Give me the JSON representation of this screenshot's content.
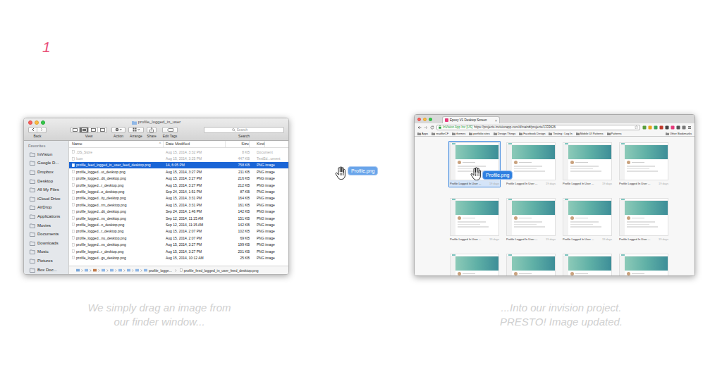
{
  "step": "1",
  "finder": {
    "title": "profile_logged_in_user",
    "toolbar": [
      {
        "label": "Back",
        "kind": "nav"
      },
      {
        "label": "View",
        "kind": "view"
      },
      {
        "label": "Action",
        "kind": "action"
      },
      {
        "label": "Arrange",
        "kind": "arrange"
      },
      {
        "label": "Share",
        "kind": "share"
      },
      {
        "label": "Edit Tags",
        "kind": "tags"
      }
    ],
    "search": {
      "placeholder": "Search",
      "label": "Search"
    },
    "sidebar": {
      "header": "Favorites",
      "items": [
        "InVision",
        "Google D...",
        "Dropbox",
        "Desktop",
        "All My Files",
        "iCloud Drive",
        "AirDrop",
        "Applications",
        "Movies",
        "Documents",
        "Downloads",
        "Music",
        "Pictures",
        "Box Doc..."
      ]
    },
    "columns": [
      {
        "label": "Name",
        "sort": "^"
      },
      {
        "label": "Date Modified"
      },
      {
        "label": "Size"
      },
      {
        "label": "Kind"
      }
    ],
    "rows": [
      {
        "name": ".DS_Store",
        "date": "Aug 15, 2014, 3:32 PM",
        "size": "8 KB",
        "kind": "Document",
        "selected": false,
        "disabled": true
      },
      {
        "name": "Icon",
        "date": "Aug 15, 2014, 3:25 PM",
        "size": "447 KB",
        "kind": "TextEd...ument",
        "selected": false,
        "disabled": true
      },
      {
        "name": "profile_feed_logged_in_user_feed_desktop.png",
        "date": "14, 6:05 PM",
        "size": "758 KB",
        "kind": "PNG image",
        "selected": true,
        "disabled": false
      },
      {
        "name": "profile_logged...ut_desktop.png",
        "date": "Aug 15, 2014, 3:27 PM",
        "size": "211 KB",
        "kind": "PNG image",
        "selected": false,
        "disabled": false
      },
      {
        "name": "profile_logged...dit_desktop.png",
        "date": "Aug 15, 2014, 3:27 PM",
        "size": "216 KB",
        "kind": "PNG image",
        "selected": false,
        "disabled": false
      },
      {
        "name": "profile_logged...r_desktop.png",
        "date": "Aug 15, 2014, 3:27 PM",
        "size": "212 KB",
        "kind": "PNG image",
        "selected": false,
        "disabled": false
      },
      {
        "name": "profile_logged...o_desktop.png",
        "date": "Sep 24, 2014, 1:51 PM",
        "size": "87 KB",
        "kind": "PNG image",
        "selected": false,
        "disabled": false
      },
      {
        "name": "profile_logged...ity_desktop.png",
        "date": "Aug 15, 2014, 3:31 PM",
        "size": "164 KB",
        "kind": "PNG image",
        "selected": false,
        "disabled": false
      },
      {
        "name": "profile_logged...rm_desktop.png",
        "date": "Aug 15, 2014, 3:31 PM",
        "size": "161 KB",
        "kind": "PNG image",
        "selected": false,
        "disabled": false
      },
      {
        "name": "profile_logged...dit_desktop.png",
        "date": "Sep 24, 2014, 1:46 PM",
        "size": "142 KB",
        "kind": "PNG image",
        "selected": false,
        "disabled": false
      },
      {
        "name": "profile_logged...ns_desktop.png",
        "date": "Sep 12, 2014, 11:15 AM",
        "size": "151 KB",
        "kind": "PNG image",
        "selected": false,
        "disabled": false
      },
      {
        "name": "profile_logged...n_desktop.png",
        "date": "Sep 12, 2014, 11:15 AM",
        "size": "142 KB",
        "kind": "PNG image",
        "selected": false,
        "disabled": false
      },
      {
        "name": "profile_logged...r_desktop.png",
        "date": "Aug 15, 2014, 2:07 PM",
        "size": "102 KB",
        "kind": "PNG image",
        "selected": false,
        "disabled": false
      },
      {
        "name": "profile_logged...nu_desktop.png",
        "date": "Aug 15, 2014, 2:07 PM",
        "size": "69 KB",
        "kind": "PNG image",
        "selected": false,
        "disabled": false
      },
      {
        "name": "profile_logged...ns_desktop.png",
        "date": "Aug 15, 2014, 3:27 PM",
        "size": "199 KB",
        "kind": "PNG image",
        "selected": false,
        "disabled": false
      },
      {
        "name": "profile_logged...r_desktop.png",
        "date": "Aug 15, 2014, 3:27 PM",
        "size": "201 KB",
        "kind": "PNG image",
        "selected": false,
        "disabled": false
      },
      {
        "name": "profile_logged...gs_desktop.png",
        "date": "Aug 15, 2014, 10:12 AM",
        "size": "25 KB",
        "kind": "PNG image",
        "selected": false,
        "disabled": false
      }
    ],
    "path": [
      "profile_logge...",
      "profile_feed_logged_in_user_feed_desktop.png"
    ]
  },
  "drag": {
    "label": "Profile.png"
  },
  "drop": {
    "label": "Profile.png"
  },
  "browser": {
    "tab": {
      "title": "Epoxy V1 Desktop Screen",
      "close": "×"
    },
    "site": "InVision App Inc [US]",
    "url": "https://projects.invisionapp.com/d/main#/projects/1333626",
    "bookmarks": [
      "Apps",
      "readforCF",
      "themes",
      "portfolio sites",
      "Design Things",
      "Facebook Design",
      "Testing : Log In",
      "Mobile UI Patterns",
      "Patterns"
    ],
    "other_bookmarks": "Other Bookmarks",
    "screens": [
      {
        "title": "Profile Logged In User ...",
        "age": "19 days",
        "selected": true
      },
      {
        "title": "Profile Logged In User ...",
        "age": "19 days",
        "selected": false
      },
      {
        "title": "Profile Logged In User ...",
        "age": "19 days",
        "selected": false
      },
      {
        "title": "Profile Logged In User ...",
        "age": "19 days",
        "selected": false
      },
      {
        "title": "Profile Logged In User ...",
        "age": "19 days",
        "selected": false
      },
      {
        "title": "Profile Logged In User ...",
        "age": "19 days",
        "selected": false
      },
      {
        "title": "Profile Logged In User ...",
        "age": "19 days",
        "selected": false
      },
      {
        "title": "Profile Logged In User ...",
        "age": "19 days",
        "selected": false
      },
      {
        "selected": false
      },
      {
        "selected": false
      },
      {
        "selected": false
      },
      {
        "selected": false
      }
    ]
  },
  "captions": [
    {
      "lines": [
        "We simply drag an image from",
        "our finder window..."
      ]
    },
    {
      "lines": [
        "...Into our invision project.",
        "PRESTO! Image updated."
      ]
    }
  ]
}
